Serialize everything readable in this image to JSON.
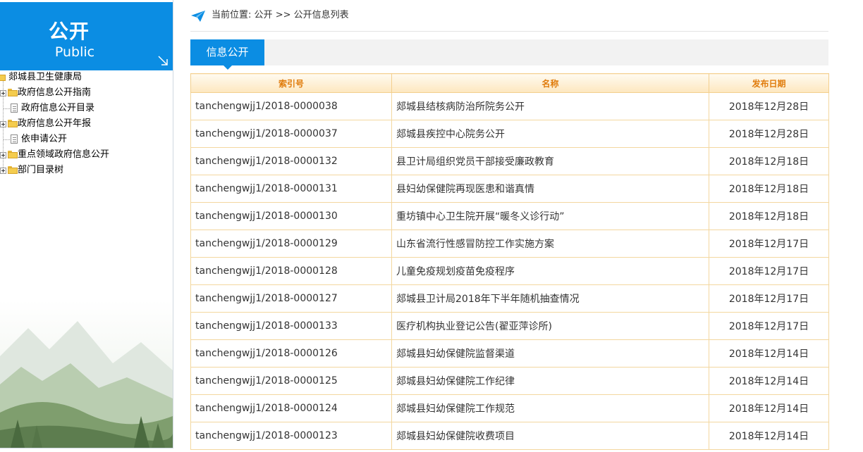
{
  "sidebar": {
    "title": "公开",
    "subtitle": "Public",
    "tree": {
      "root": "郯城县卫生健康局",
      "items": [
        {
          "label": "政府信息公开指南",
          "kind": "folder"
        },
        {
          "label": "政府信息公开目录",
          "kind": "doc"
        },
        {
          "label": "政府信息公开年报",
          "kind": "folder"
        },
        {
          "label": "依申请公开",
          "kind": "doc"
        },
        {
          "label": "重点领域政府信息公开",
          "kind": "folder"
        },
        {
          "label": "部门目录树",
          "kind": "folder"
        }
      ]
    }
  },
  "breadcrumb": {
    "label": "当前位置:",
    "path": [
      "公开",
      "公开信息列表"
    ],
    "separator": ">>"
  },
  "tab": {
    "label": "信息公开"
  },
  "table": {
    "headers": [
      "索引号",
      "名称",
      "发布日期"
    ],
    "rows": [
      [
        "tanchengwjj1/2018-0000038",
        "郯城县结核病防治所院务公开",
        "2018年12月28日"
      ],
      [
        "tanchengwjj1/2018-0000037",
        "郯城县疾控中心院务公开",
        "2018年12月28日"
      ],
      [
        "tanchengwjj1/2018-0000132",
        "县卫计局组织党员干部接受廉政教育",
        "2018年12月18日"
      ],
      [
        "tanchengwjj1/2018-0000131",
        "县妇幼保健院再现医患和谐真情",
        "2018年12月18日"
      ],
      [
        "tanchengwjj1/2018-0000130",
        "重坊镇中心卫生院开展“暖冬义诊行动”",
        "2018年12月18日"
      ],
      [
        "tanchengwjj1/2018-0000129",
        "山东省流行性感冒防控工作实施方案",
        "2018年12月17日"
      ],
      [
        "tanchengwjj1/2018-0000128",
        "儿童免疫规划疫苗免疫程序",
        "2018年12月17日"
      ],
      [
        "tanchengwjj1/2018-0000127",
        "郯城县卫计局2018年下半年随机抽查情况",
        "2018年12月17日"
      ],
      [
        "tanchengwjj1/2018-0000133",
        "医疗机构执业登记公告(翟亚萍诊所)",
        "2018年12月17日"
      ],
      [
        "tanchengwjj1/2018-0000126",
        "郯城县妇幼保健院监督渠道",
        "2018年12月14日"
      ],
      [
        "tanchengwjj1/2018-0000125",
        "郯城县妇幼保健院工作纪律",
        "2018年12月14日"
      ],
      [
        "tanchengwjj1/2018-0000124",
        "郯城县妇幼保健院工作规范",
        "2018年12月14日"
      ],
      [
        "tanchengwjj1/2018-0000123",
        "郯城县妇幼保健院收费项目",
        "2018年12月14日"
      ]
    ]
  },
  "colors": {
    "accent": "#0b8de3",
    "header_text": "#e07c0c",
    "grid_border": "#f3d79f"
  }
}
